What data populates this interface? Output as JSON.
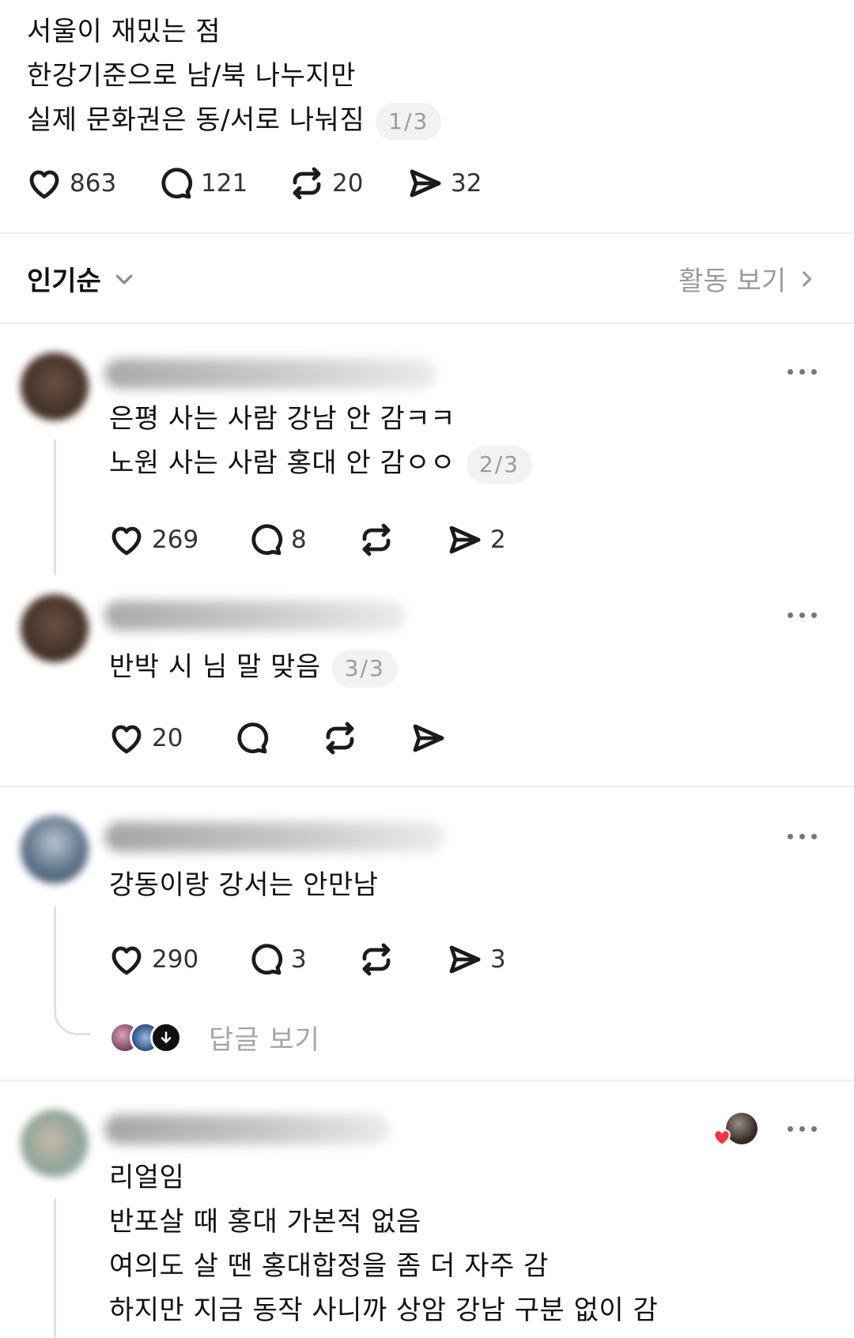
{
  "post": {
    "lines": [
      "서울이 재밌는 점",
      "한강기준으로 남/북 나누지만",
      "실제 문화권은 동/서로 나눠짐"
    ],
    "page": "1/3",
    "likes": "863",
    "comments": "121",
    "reposts": "20",
    "shares": "32"
  },
  "sort": {
    "label": "인기순",
    "activity_label": "활동 보기"
  },
  "comments": [
    {
      "lines": [
        "은평 사는 사람 강남 안 감ㅋㅋ",
        "노원 사는 사람 홍대 안 감ㅇㅇ"
      ],
      "page": "2/3",
      "likes": "269",
      "comments": "8",
      "reposts": "",
      "shares": "2",
      "avatar_color": "#5a4438"
    },
    {
      "lines": [
        "반박 시 님 말 맞음"
      ],
      "page": "3/3",
      "likes": "20",
      "comments": "",
      "reposts": "",
      "shares": "",
      "avatar_color": "#5a4438"
    },
    {
      "lines": [
        "강동이랑 강서는 안만남"
      ],
      "likes": "290",
      "comments": "3",
      "reposts": "",
      "shares": "3",
      "view_replies": "답글 보기",
      "avatar_color": "#4a5e72"
    },
    {
      "lines": [
        "리얼임",
        "반포살 때 홍대 가본적 없음",
        "여의도 살 땐 홍대합정을 좀 더 자주 감",
        "하지만 지금 동작 사니까 상암 강남 구분 없이 감"
      ],
      "avatar_color": "#8fa39a"
    }
  ],
  "icons": {
    "like": "heart-icon",
    "comment": "comment-bubble-icon",
    "repost": "repost-icon",
    "share": "send-icon",
    "more": "more-dots-icon",
    "sort_chevron": "chevron-down-icon",
    "activity_chevron": "chevron-right-icon",
    "replies_down": "arrow-down-icon"
  },
  "colors": {
    "text": "#111111",
    "muted": "#9b9b9b",
    "pill_bg": "#f2f2f2",
    "divider": "#ececec",
    "heart_red": "#ff3040"
  }
}
